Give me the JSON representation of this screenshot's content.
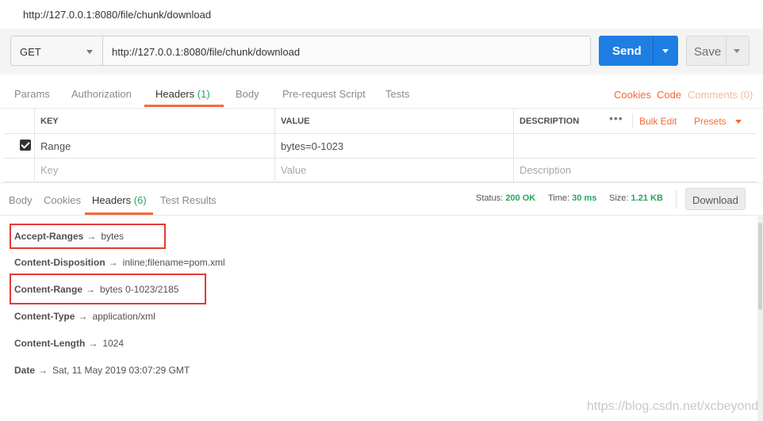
{
  "window": {
    "title": "http://127.0.0.1:8080/file/chunk/download"
  },
  "request": {
    "method": "GET",
    "url": "http://127.0.0.1:8080/file/chunk/download",
    "send_label": "Send",
    "save_label": "Save"
  },
  "request_tabs": {
    "params": "Params",
    "authorization": "Authorization",
    "headers": "Headers",
    "headers_count": "(1)",
    "body": "Body",
    "prerequest": "Pre-request Script",
    "tests": "Tests",
    "active": "Headers"
  },
  "request_links": {
    "cookies": "Cookies",
    "code": "Code",
    "comments": "Comments (0)"
  },
  "headers_table": {
    "columns": {
      "key": "KEY",
      "value": "VALUE",
      "description": "DESCRIPTION"
    },
    "dots": "•••",
    "bulk_edit": "Bulk Edit",
    "presets": "Presets",
    "rows": [
      {
        "checked": true,
        "key": "Range",
        "value": "bytes=0-1023",
        "description": ""
      }
    ],
    "placeholder": {
      "key": "Key",
      "value": "Value",
      "description": "Description"
    }
  },
  "response_tabs": {
    "body": "Body",
    "cookies": "Cookies",
    "headers": "Headers",
    "headers_count": "(6)",
    "test_results": "Test Results",
    "active": "Headers"
  },
  "response_status": {
    "status_label": "Status:",
    "status_value": "200 OK",
    "time_label": "Time:",
    "time_value": "30 ms",
    "size_label": "Size:",
    "size_value": "1.21 KB",
    "download_label": "Download"
  },
  "response_headers": [
    {
      "key": "Accept-Ranges",
      "value": "bytes",
      "highlighted": true
    },
    {
      "key": "Content-Disposition",
      "value": "inline;filename=pom.xml",
      "highlighted": false
    },
    {
      "key": "Content-Range",
      "value": "bytes 0-1023/2185",
      "highlighted": true
    },
    {
      "key": "Content-Type",
      "value": "application/xml",
      "highlighted": false
    },
    {
      "key": "Content-Length",
      "value": "1024",
      "highlighted": false
    },
    {
      "key": "Date",
      "value": "Sat, 11 May 2019 03:07:29 GMT",
      "highlighted": false
    }
  ],
  "arrow": "→",
  "watermark": "https://blog.csdn.net/xcbeyond",
  "colors": {
    "accent": "#f26b3a",
    "send_blue": "#1f7ee3",
    "success_green": "#26a65b",
    "highlight_red": "#e53935"
  }
}
